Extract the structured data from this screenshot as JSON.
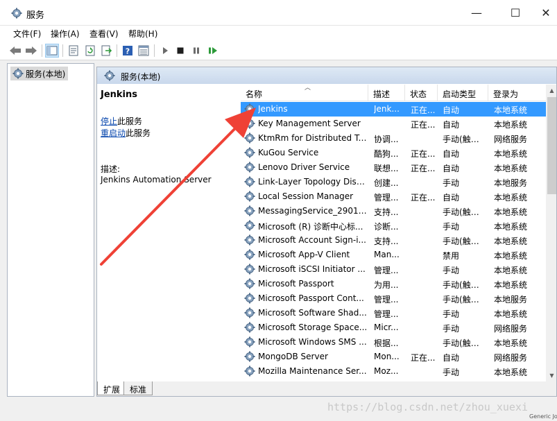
{
  "window": {
    "title": "服务",
    "min_symbol": "—",
    "max_symbol": "☐",
    "close_symbol": "✕"
  },
  "menu": [
    "文件(F)",
    "操作(A)",
    "查看(V)",
    "帮助(H)"
  ],
  "toolbar": [
    "back-arrow-icon",
    "forward-arrow-icon",
    "show-tree-icon",
    "properties-icon",
    "refresh-icon",
    "export-icon",
    "help-icon",
    "view-icon",
    "play-icon",
    "stop-icon",
    "pause-icon",
    "restart-icon"
  ],
  "tree": {
    "root_label": "服务(本地)"
  },
  "main": {
    "title": "服务(本地)",
    "selected_name": "Jenkins",
    "stop_link": "停止",
    "stop_suffix": "此服务",
    "restart_link": "重启动",
    "restart_suffix": "此服务",
    "desc_label": "描述:",
    "desc_text": "Jenkins Automation Server"
  },
  "columns": [
    "名称",
    "描述",
    "状态",
    "启动类型",
    "登录为"
  ],
  "services": [
    [
      "Jenkins",
      "Jenk...",
      "正在...",
      "自动",
      "本地系统"
    ],
    [
      "Key Management Server",
      "",
      "正在...",
      "自动",
      "本地系统"
    ],
    [
      "KtmRm for Distributed Tr...",
      "协调...",
      "",
      "手动(触发...",
      "网络服务"
    ],
    [
      "KuGou Service",
      "酷狗...",
      "正在...",
      "自动",
      "本地系统"
    ],
    [
      "Lenovo Driver Service",
      "联想...",
      "正在...",
      "自动",
      "本地系统"
    ],
    [
      "Link-Layer Topology Disc...",
      "创建...",
      "",
      "手动",
      "本地服务"
    ],
    [
      "Local Session Manager",
      "管理...",
      "正在...",
      "自动",
      "本地系统"
    ],
    [
      "MessagingService_29013...",
      "支持...",
      "",
      "手动(触发...",
      "本地系统"
    ],
    [
      "Microsoft (R) 诊断中心标...",
      "诊断...",
      "",
      "手动",
      "本地系统"
    ],
    [
      "Microsoft Account Sign-i...",
      "支持...",
      "",
      "手动(触发...",
      "本地系统"
    ],
    [
      "Microsoft App-V Client",
      "Man...",
      "",
      "禁用",
      "本地系统"
    ],
    [
      "Microsoft iSCSI Initiator ...",
      "管理...",
      "",
      "手动",
      "本地系统"
    ],
    [
      "Microsoft Passport",
      "为用...",
      "",
      "手动(触发...",
      "本地系统"
    ],
    [
      "Microsoft Passport Cont...",
      "管理...",
      "",
      "手动(触发...",
      "本地服务"
    ],
    [
      "Microsoft Software Shad...",
      "管理...",
      "",
      "手动",
      "本地系统"
    ],
    [
      "Microsoft Storage Space...",
      "Micr...",
      "",
      "手动",
      "网络服务"
    ],
    [
      "Microsoft Windows SMS ...",
      "根据...",
      "",
      "手动(触发...",
      "本地系统"
    ],
    [
      "MongoDB Server",
      "Mon...",
      "正在...",
      "自动",
      "网络服务"
    ],
    [
      "Mozilla Maintenance Ser...",
      "Moz...",
      "",
      "手动",
      "本地系统"
    ]
  ],
  "tabs": [
    "扩展",
    "标准"
  ],
  "watermark": "https://blog.csdn.net/zhou_xuexi",
  "corner_text": "Generic Jo",
  "colors": {
    "selected": "#3399ff",
    "arrow": "#ef4136",
    "link": "#0645ad"
  }
}
